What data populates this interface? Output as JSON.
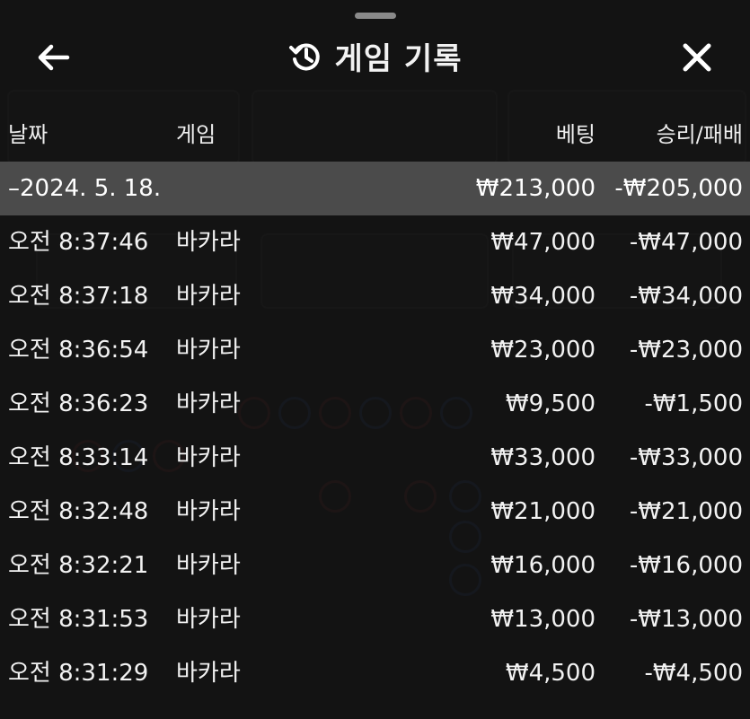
{
  "header": {
    "title": "게임 기록",
    "back_icon": "arrow-left-icon",
    "history_icon": "history-icon",
    "close_icon": "close-icon"
  },
  "columns": {
    "date": "날짜",
    "game": "게임",
    "bet": "베팅",
    "result": "승리/패배"
  },
  "summary": {
    "date": "–2024. 5. 18.",
    "bet": "₩213,000",
    "result": "-₩205,000"
  },
  "rows": [
    {
      "time": "오전 8:37:46",
      "game": "바카라",
      "bet": "₩47,000",
      "result": "-₩47,000"
    },
    {
      "time": "오전 8:37:18",
      "game": "바카라",
      "bet": "₩34,000",
      "result": "-₩34,000"
    },
    {
      "time": "오전 8:36:54",
      "game": "바카라",
      "bet": "₩23,000",
      "result": "-₩23,000"
    },
    {
      "time": "오전 8:36:23",
      "game": "바카라",
      "bet": "₩9,500",
      "result": "-₩1,500"
    },
    {
      "time": "오전 8:33:14",
      "game": "바카라",
      "bet": "₩33,000",
      "result": "-₩33,000"
    },
    {
      "time": "오전 8:32:48",
      "game": "바카라",
      "bet": "₩21,000",
      "result": "-₩21,000"
    },
    {
      "time": "오전 8:32:21",
      "game": "바카라",
      "bet": "₩16,000",
      "result": "-₩16,000"
    },
    {
      "time": "오전 8:31:53",
      "game": "바카라",
      "bet": "₩13,000",
      "result": "-₩13,000"
    },
    {
      "time": "오전 8:31:29",
      "game": "바카라",
      "bet": "₩4,500",
      "result": "-₩4,500"
    }
  ]
}
